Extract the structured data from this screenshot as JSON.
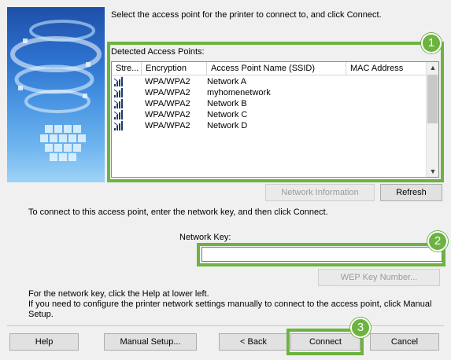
{
  "instruction": "Select the access point for the printer to connect to, and click Connect.",
  "access_points": {
    "label": "Detected Access Points:",
    "columns": [
      "Stre...",
      "Encryption",
      "Access Point Name (SSID)",
      "MAC Address"
    ],
    "rows": [
      {
        "encryption": "WPA/WPA2",
        "ssid": "Network A",
        "mac": ""
      },
      {
        "encryption": "WPA/WPA2",
        "ssid": "myhomenetwork",
        "mac": ""
      },
      {
        "encryption": "WPA/WPA2",
        "ssid": "Network B",
        "mac": ""
      },
      {
        "encryption": "WPA/WPA2",
        "ssid": "Network C",
        "mac": ""
      },
      {
        "encryption": "WPA/WPA2",
        "ssid": "Network D",
        "mac": ""
      }
    ]
  },
  "buttons": {
    "network_info": "Network Information",
    "refresh": "Refresh",
    "wep_key": "WEP Key Number...",
    "help": "Help",
    "manual_setup": "Manual Setup...",
    "back": "< Back",
    "connect": "Connect",
    "cancel": "Cancel"
  },
  "network_key_instruction": "To connect to this access point, enter the network key, and then click Connect.",
  "network_key_label": "Network Key:",
  "network_key_value": "",
  "help_note": [
    "For the network key, click the Help at lower left.",
    "If you need to configure the printer network settings manually to connect to the access point, click Manual",
    "Setup."
  ],
  "callouts": [
    "1",
    "2",
    "3"
  ],
  "colors": {
    "highlight": "#6cb33f",
    "art": "#2d72cf"
  },
  "icons": {
    "signal": "signal-strength-icon",
    "scroll_up": "scroll-up-arrow-icon",
    "scroll_down": "scroll-down-arrow-icon"
  }
}
